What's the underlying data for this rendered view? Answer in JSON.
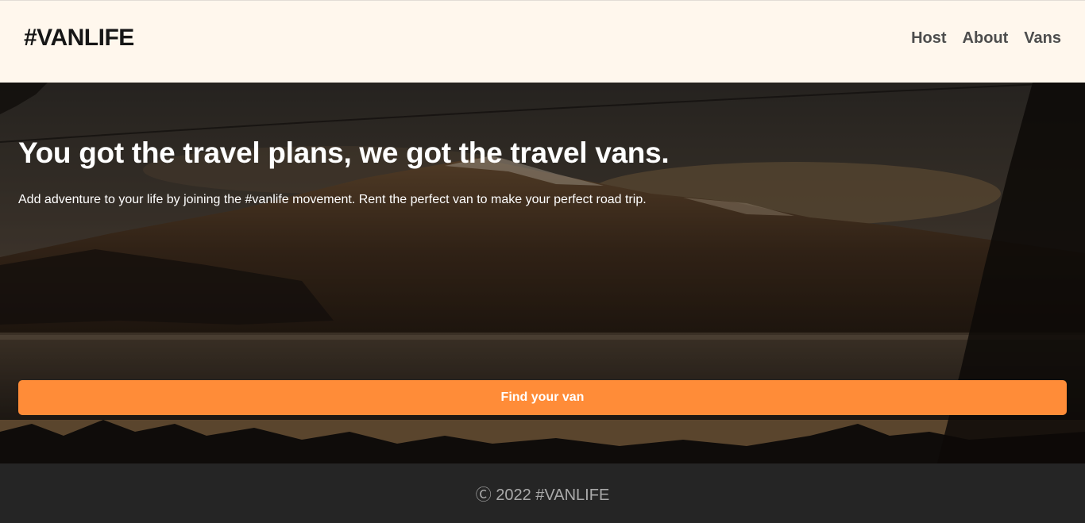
{
  "header": {
    "logo": "#VANLIFE",
    "nav": [
      {
        "label": "Host"
      },
      {
        "label": "About"
      },
      {
        "label": "Vans"
      }
    ]
  },
  "hero": {
    "title": "You got the travel plans, we got the travel vans.",
    "text": "Add adventure to your life by joining the #vanlife movement. Rent the perfect van to make your perfect road trip.",
    "button_label": "Find your van"
  },
  "footer": {
    "text": "Ⓒ 2022 #VANLIFE"
  },
  "colors": {
    "header_bg": "#FFF7ED",
    "accent": "#FF8C38",
    "footer_bg": "#252525",
    "logo": "#161616"
  }
}
